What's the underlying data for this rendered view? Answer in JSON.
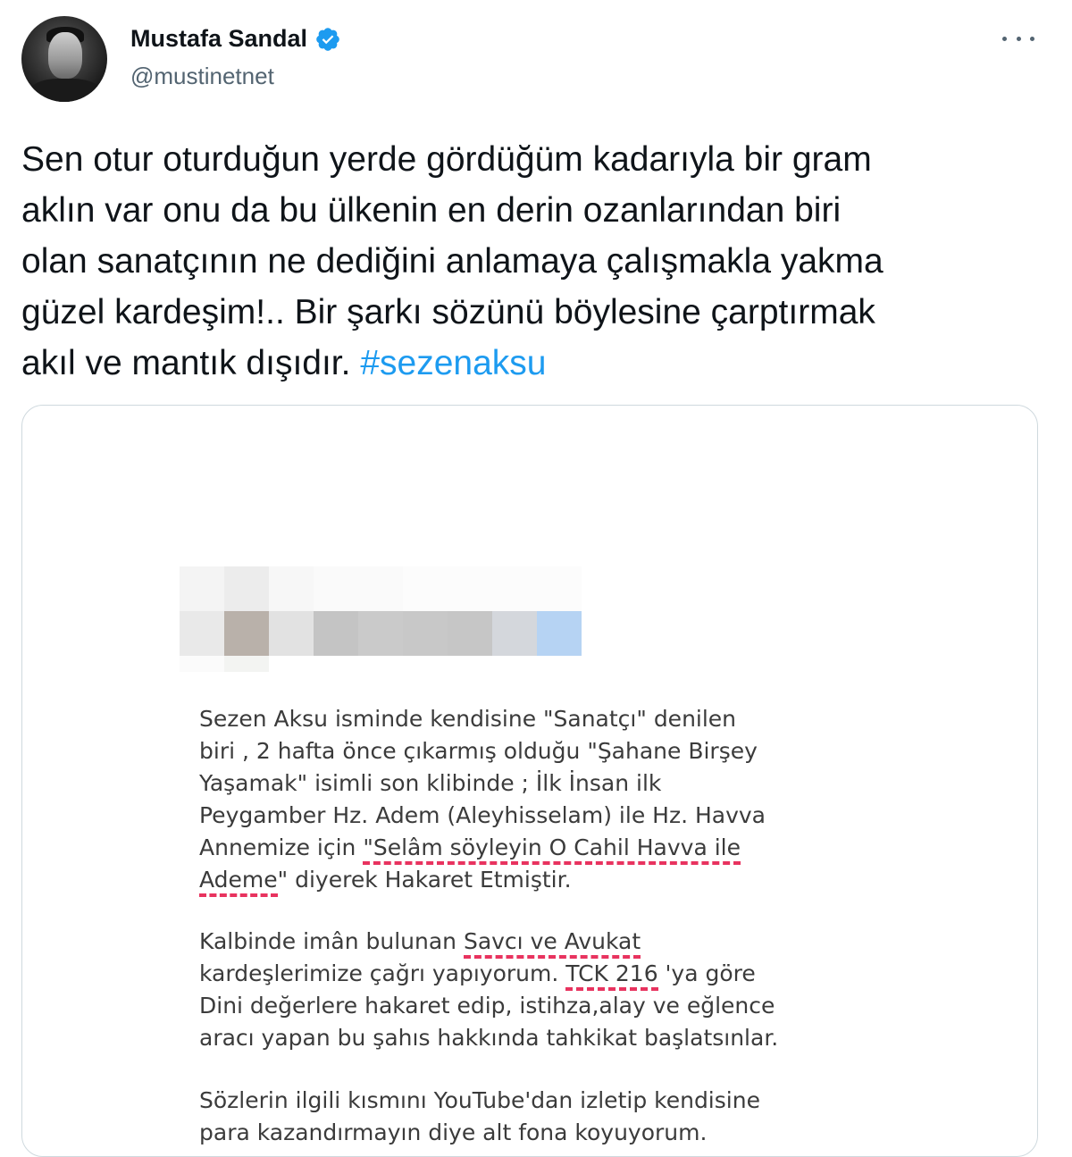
{
  "author": {
    "name": "Mustafa Sandal",
    "handle": "@mustinetnet",
    "verified_icon": "verified-badge-icon"
  },
  "tweet": {
    "lines": [
      "Sen otur oturduğun yerde gördüğüm kadarıyla bir gram",
      "aklın var onu da bu ülkenin en derin ozanlarından biri",
      "olan sanatçının ne dediğini anlamaya çalışmakla yakma",
      "güzel kardeşim!.. Bir şarkı sözünü böylesine çarptırmak"
    ],
    "last_line_text": "akıl ve mantık dışıdır. ",
    "hashtag": "#sezenaksu"
  },
  "colors": {
    "accent": "#1d9bf0",
    "underline": "#e8335f",
    "secondary_text": "#536471"
  },
  "media": {
    "paragraph1": {
      "line1": "Sezen Aksu isminde kendisine \"Sanatçı\" denilen",
      "line2": "biri , 2 hafta önce çıkarmış olduğu \"Şahane Birşey",
      "line3": "Yaşamak\" isimli son klibinde ; İlk İnsan ilk",
      "line4": "Peygamber Hz. Adem (Aleyhisselam) ile Hz. Havva",
      "line5_plain": "Annemize için ",
      "line5_underlined": "\"Selâm söyleyin O Cahil Havva ile",
      "line6_underlined": "Ademe",
      "line6_plain": "\" diyerek Hakaret Etmiştir."
    },
    "paragraph2": {
      "line1_plain": "Kalbinde imân bulunan ",
      "line1_underlined": "Savcı ve Avukat",
      "line2_plain_a": "kardeşlerimize çağrı yapıyorum. ",
      "line2_underlined": "TCK 216",
      "line2_plain_b": " 'ya göre",
      "line3": "Dini değerlere hakaret edip, istihza,alay ve eğlence",
      "line4": "aracı yapan bu şahıs hakkında tahkikat başlatsınlar."
    },
    "paragraph3": {
      "line1": "Sözlerin ilgili kısmını YouTube'dan izletip kendisine",
      "line2": "para kazandırmayın diye alt fona koyuyorum."
    }
  }
}
